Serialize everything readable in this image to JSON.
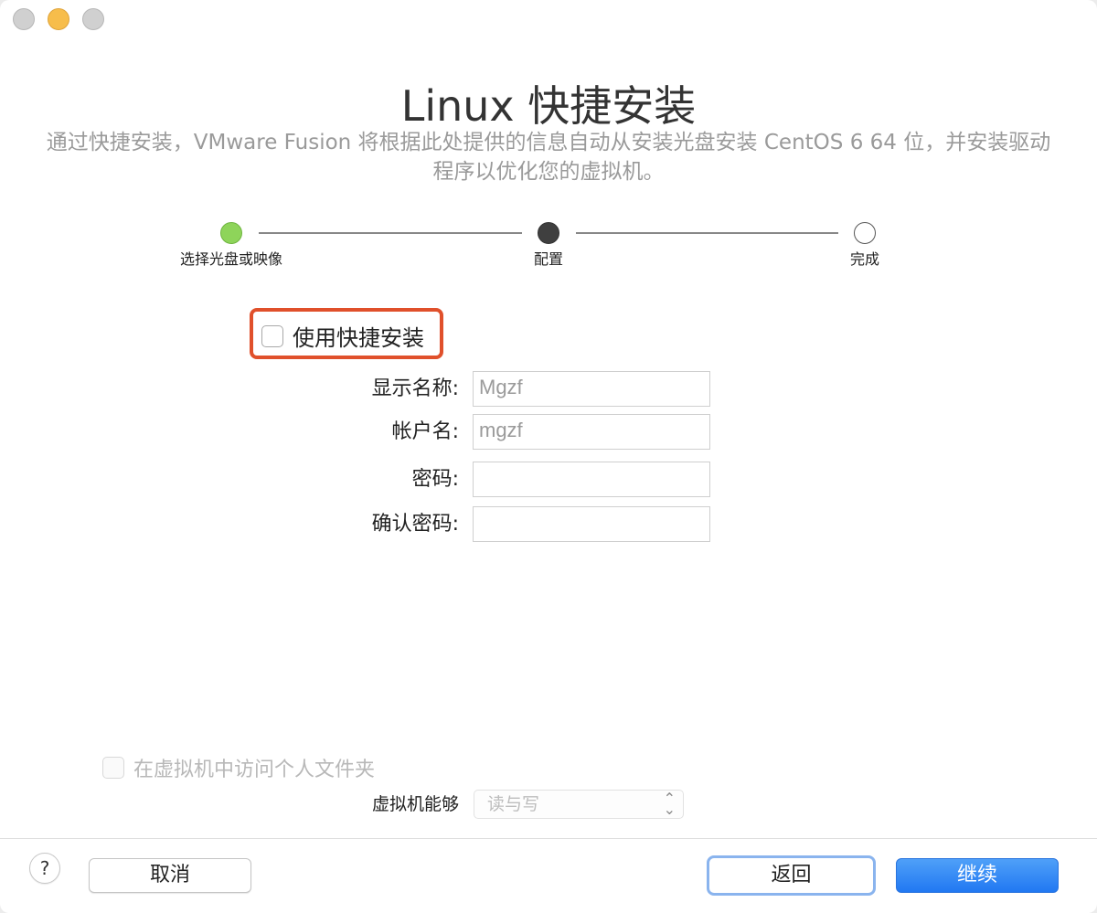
{
  "window": {
    "title": "Linux 快捷安装",
    "subtitle": "通过快捷安装，VMware Fusion 将根据此处提供的信息自动从安装光盘安装 CentOS 6 64 位，并安装驱动程序以优化您的虚拟机。"
  },
  "stepper": {
    "steps": [
      {
        "label": "选择光盘或映像",
        "state": "done"
      },
      {
        "label": "配置",
        "state": "current"
      },
      {
        "label": "完成",
        "state": "todo"
      }
    ]
  },
  "quick_install": {
    "label": "使用快捷安装",
    "checked": false
  },
  "form": {
    "display_name_label": "显示名称:",
    "display_name_value": "Mgzf",
    "account_label": "帐户名:",
    "account_value": "mgzf",
    "password_label": "密码:",
    "password_value": "",
    "confirm_label": "确认密码:",
    "confirm_value": ""
  },
  "sharing": {
    "folder_label": "在虚拟机中访问个人文件夹",
    "checked": false,
    "vm_can_label": "虚拟机能够",
    "access_selected": "读与写"
  },
  "buttons": {
    "help": "?",
    "cancel": "取消",
    "back": "返回",
    "next": "继续"
  },
  "colors": {
    "step_done": "#8ed45a",
    "step_current": "#3f3f3f",
    "highlight": "#e0502b",
    "primary": "#2178f2"
  }
}
